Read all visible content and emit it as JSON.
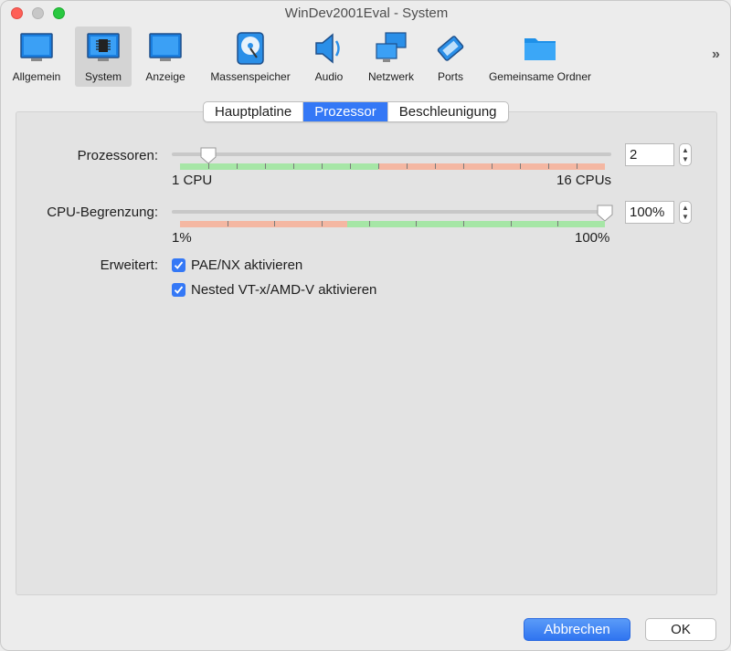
{
  "window": {
    "title": "WinDev2001Eval - System"
  },
  "toolbar": {
    "items": [
      {
        "label": "Allgemein",
        "icon": "monitor-icon"
      },
      {
        "label": "System",
        "icon": "chip-icon",
        "selected": true
      },
      {
        "label": "Anzeige",
        "icon": "display-icon"
      },
      {
        "label": "Massenspeicher",
        "icon": "disk-icon"
      },
      {
        "label": "Audio",
        "icon": "speaker-icon"
      },
      {
        "label": "Netzwerk",
        "icon": "network-icon"
      },
      {
        "label": "Ports",
        "icon": "ports-icon"
      },
      {
        "label": "Gemeinsame Ordner",
        "icon": "folder-icon"
      }
    ],
    "overflow": "»"
  },
  "tabs": [
    "Hauptplatine",
    "Prozessor",
    "Beschleunigung"
  ],
  "active_tab": "Prozessor",
  "processors": {
    "label": "Prozessoren:",
    "min_label": "1 CPU",
    "max_label": "16 CPUs",
    "value": "2",
    "min": 1,
    "max": 16,
    "current": 2,
    "green_until": 8
  },
  "cpu_limit": {
    "label": "CPU-Begrenzung:",
    "min_label": "1%",
    "max_label": "100%",
    "value": "100%",
    "min": 1,
    "max": 100,
    "current": 100,
    "green_from": 40
  },
  "extended": {
    "label": "Erweitert:",
    "options": [
      {
        "label": "PAE/NX aktivieren",
        "checked": true
      },
      {
        "label": "Nested VT-x/AMD-V aktivieren",
        "checked": true
      }
    ]
  },
  "buttons": {
    "cancel": "Abbrechen",
    "ok": "OK"
  },
  "colors": {
    "accent": "#3478f6",
    "green_zone": "#a6e6a6",
    "red_zone": "#f4b7a2"
  }
}
